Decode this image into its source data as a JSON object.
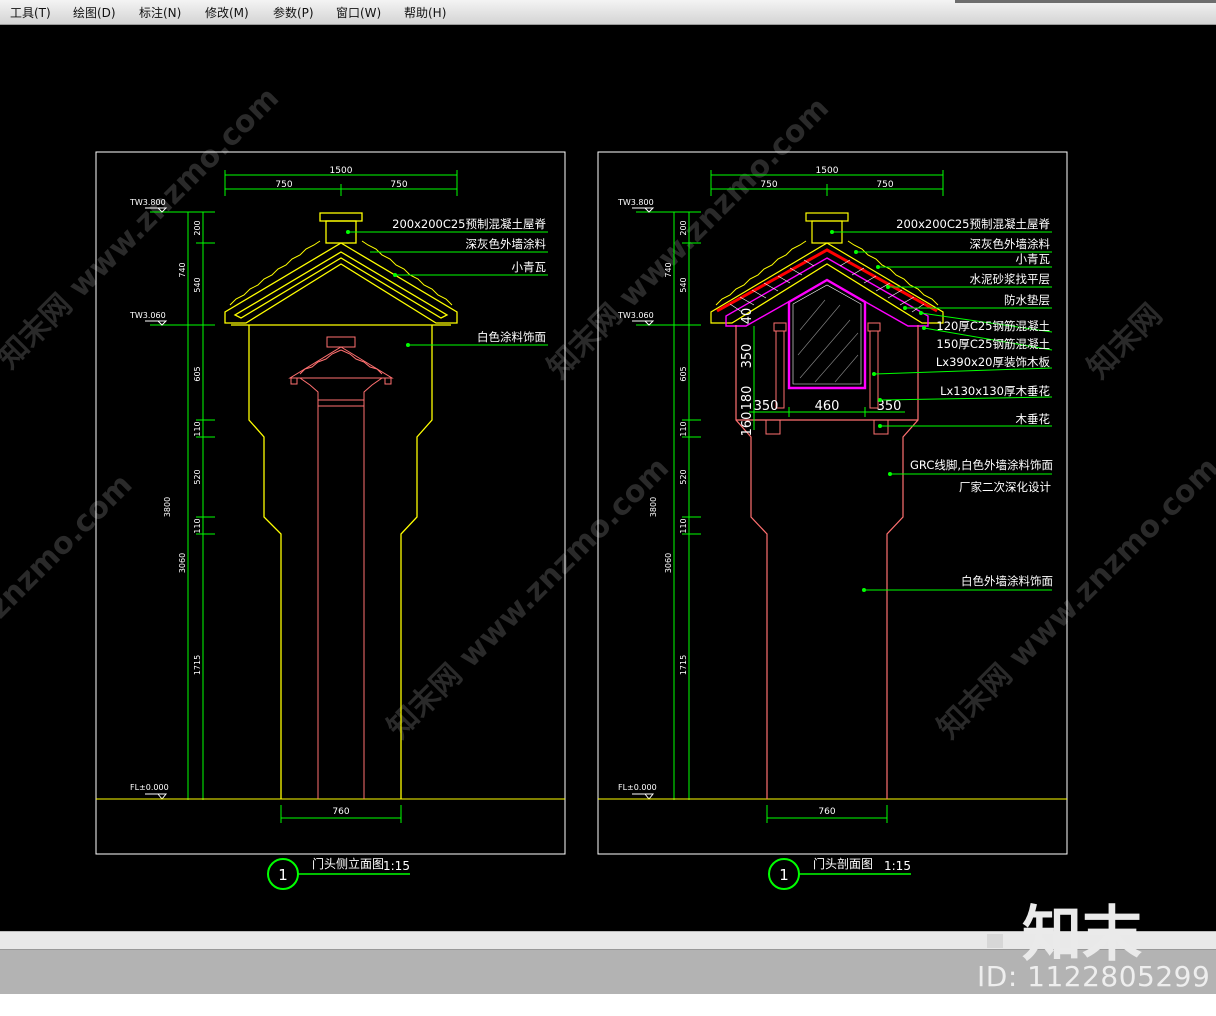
{
  "menu": {
    "items": [
      "工具(T)",
      "绘图(D)",
      "标注(N)",
      "修改(M)",
      "参数(P)",
      "窗口(W)",
      "帮助(H)"
    ]
  },
  "drawing": {
    "left": {
      "title": "门头侧立面图",
      "scale": "1:15",
      "index": "1",
      "dim_top": {
        "total": "1500",
        "left": "750",
        "right": "750"
      },
      "dim_bottom": "760",
      "levels": [
        "TW3.800",
        "TW3.060",
        "FL±0.000"
      ],
      "dims_inner": [
        "200",
        "540",
        "605",
        "110",
        "520",
        "110",
        "1715"
      ],
      "dims_outer": [
        "740",
        "3800",
        "3060"
      ],
      "notes": [
        "200x200C25预制混凝土屋脊",
        "深灰色外墙涂料",
        "小青瓦",
        "白色涂料饰面"
      ]
    },
    "right": {
      "title": "门头剖面图",
      "scale": "1:15",
      "index": "1",
      "dim_top": {
        "total": "1500",
        "left": "750",
        "right": "750"
      },
      "dim_bottom": "760",
      "levels": [
        "TW3.800",
        "TW3.060",
        "FL±0.000"
      ],
      "dims_inner": [
        "200",
        "540",
        "605",
        "110",
        "520",
        "110",
        "1715"
      ],
      "dims_outer": [
        "740",
        "3800",
        "3060"
      ],
      "section_dims": {
        "d40": "40",
        "d350": "350",
        "d180": "180",
        "d160": "160",
        "w_left": "350",
        "w_mid": "460",
        "w_right": "350"
      },
      "notes": [
        "200x200C25预制混凝土屋脊",
        "深灰色外墙涂料",
        "小青瓦",
        "水泥砂浆找平层",
        "防水垫层",
        "120厚C25钢筋混凝土",
        "150厚C25钢筋混凝土",
        "Lx390x20厚装饰木板",
        "Lx130x130厚木垂花",
        "木垂花",
        "GRC线脚,白色外墙涂料饰面",
        "厂家二次深化设计",
        "白色外墙涂料饰面"
      ]
    }
  },
  "colors": {
    "frame": "#ffffff",
    "dim": "#00ff00",
    "outline": "#ffff00",
    "roof_section": "#ff0000",
    "section_fill": "#ff00ff",
    "column": "#ff6060"
  },
  "status": {
    "id_text": "ID: 1122805299",
    "brand": "知末"
  }
}
